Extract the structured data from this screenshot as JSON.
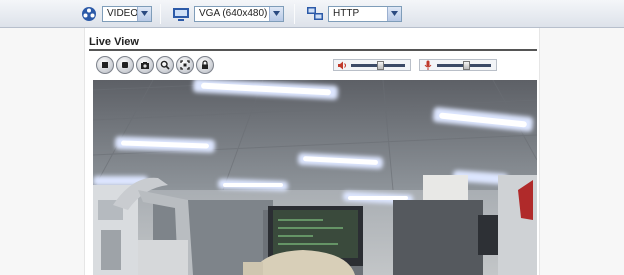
{
  "toolbar": {
    "stream_type": {
      "selected": "VIDEO",
      "icon": "stream-type-icon"
    },
    "resolution": {
      "selected": "VGA (640x480)",
      "icon": "monitor-icon"
    },
    "protocol": {
      "selected": "HTTP",
      "icon": "network-icon"
    }
  },
  "live_view": {
    "title": "Live View",
    "buttons": [
      "stop-icon",
      "record-icon",
      "snapshot-icon",
      "zoom-icon",
      "fullscreen-icon",
      "lock-icon"
    ],
    "speaker_volume": 0.55,
    "mic_volume": 0.55
  },
  "colors": {
    "accent": "#3b4a66",
    "rule": "#555555",
    "select_border": "#7f9db9"
  }
}
